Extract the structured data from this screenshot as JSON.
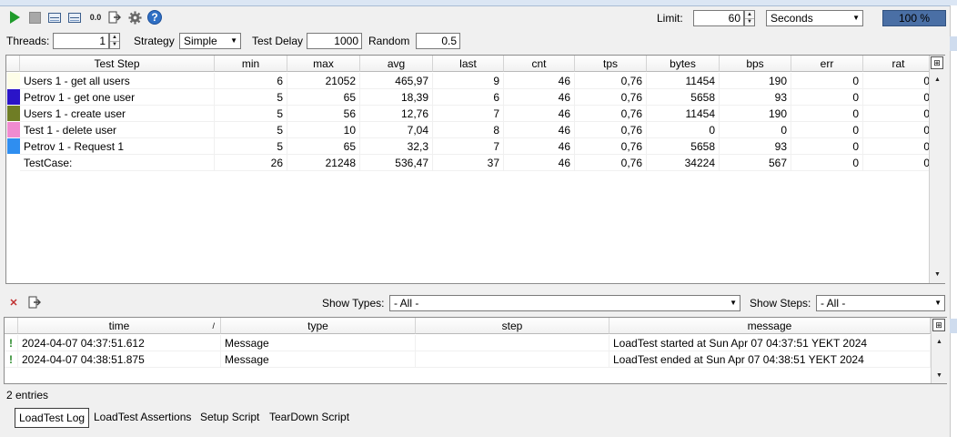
{
  "toolbar": {
    "icons": [
      "run-icon",
      "cancel-icon",
      "statistics-graph-icon",
      "statistics-history-icon",
      "reset-icon",
      "export-icon",
      "options-icon",
      "help-icon"
    ],
    "zero_label": "0.0",
    "help_label": "?",
    "limit_label": "Limit:",
    "limit_value": "60",
    "limit_type": "Seconds",
    "progress_label": "100 %",
    "progress_fraction": 1.0,
    "progress_color": "#4a6fa5"
  },
  "settings": {
    "threads_label": "Threads:",
    "threads_value": "1",
    "strategy_label": "Strategy",
    "strategy_value": "Simple",
    "test_delay_label": "Test Delay",
    "test_delay_value": "1000",
    "random_label": "Random",
    "random_value": "0.5"
  },
  "stats": {
    "columns": [
      "Test Step",
      "min",
      "max",
      "avg",
      "last",
      "cnt",
      "tps",
      "bytes",
      "bps",
      "err",
      "rat"
    ],
    "rows": [
      {
        "color": "#fdfde8",
        "cells": [
          "Users 1 - get all users",
          "6",
          "21052",
          "465,97",
          "9",
          "46",
          "0,76",
          "11454",
          "190",
          "0",
          "0"
        ]
      },
      {
        "color": "#2a14c8",
        "cells": [
          "Petrov 1 - get one user",
          "5",
          "65",
          "18,39",
          "6",
          "46",
          "0,76",
          "5658",
          "93",
          "0",
          "0"
        ]
      },
      {
        "color": "#6f7d25",
        "cells": [
          "Users 1 - create user",
          "5",
          "56",
          "12,76",
          "7",
          "46",
          "0,76",
          "11454",
          "190",
          "0",
          "0"
        ]
      },
      {
        "color": "#f08bd0",
        "cells": [
          "Test 1 - delete user",
          "5",
          "10",
          "7,04",
          "8",
          "46",
          "0,76",
          "0",
          "0",
          "0",
          "0"
        ]
      },
      {
        "color": "#2f8ef0",
        "cells": [
          "Petrov 1 - Request 1",
          "5",
          "65",
          "32,3",
          "7",
          "46",
          "0,76",
          "5658",
          "93",
          "0",
          "0"
        ]
      },
      {
        "color": "#ffffff",
        "cells": [
          "TestCase:",
          "26",
          "21248",
          "536,47",
          "37",
          "46",
          "0,76",
          "34224",
          "567",
          "0",
          "0"
        ]
      }
    ]
  },
  "log": {
    "show_types_label": "Show Types:",
    "show_types_value": "- All -",
    "show_steps_label": "Show Steps:",
    "show_steps_value": "- All -",
    "columns": [
      "time",
      "type",
      "step",
      "message"
    ],
    "sort_indicator": "/",
    "rows": [
      {
        "cells": [
          "2024-04-07 04:37:51.612",
          "Message",
          "",
          "LoadTest started at Sun Apr 07 04:37:51 YEKT 2024"
        ]
      },
      {
        "cells": [
          "2024-04-07 04:38:51.875",
          "Message",
          "",
          "LoadTest ended at Sun Apr 07 04:38:51 YEKT 2024"
        ]
      }
    ],
    "entries_label": "2 entries"
  },
  "tabs": [
    "LoadTest Log",
    "LoadTest Assertions",
    "Setup Script",
    "TearDown Script"
  ]
}
